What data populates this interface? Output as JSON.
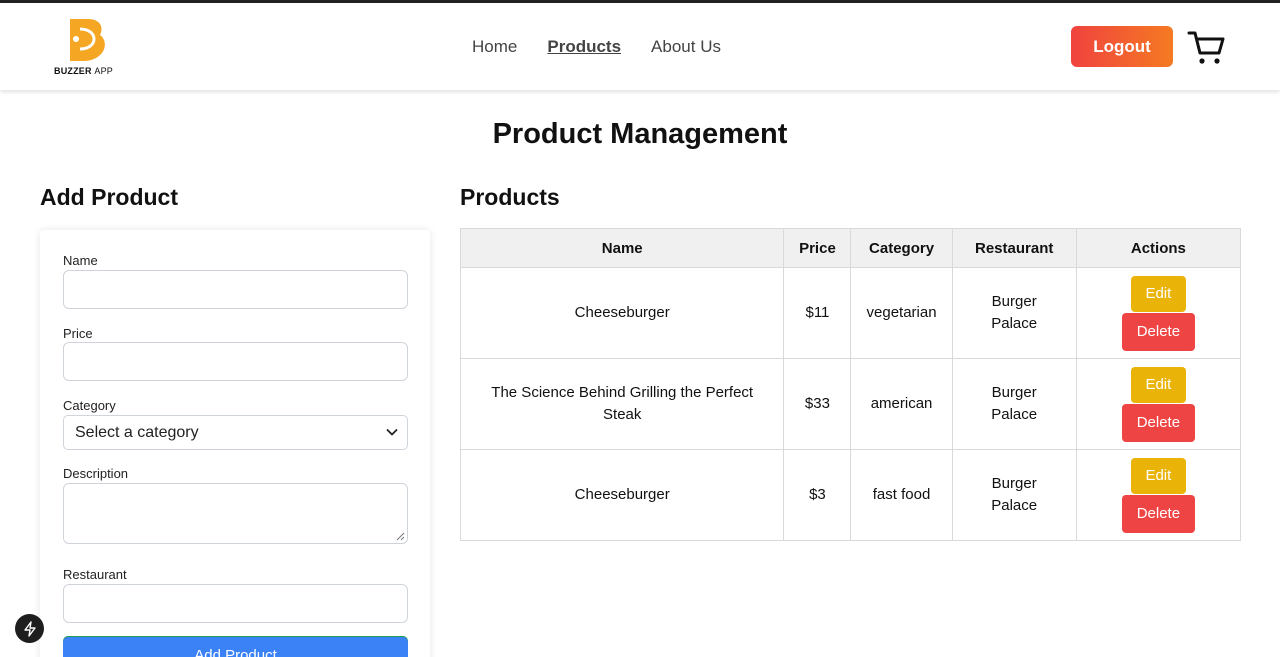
{
  "header": {
    "logo_brand": "BUZZER",
    "logo_suffix": "APP",
    "nav": [
      {
        "label": "Home",
        "active": false
      },
      {
        "label": "Products",
        "active": true
      },
      {
        "label": "About Us",
        "active": false
      }
    ],
    "logout_label": "Logout",
    "cart_icon": "shopping-cart-icon"
  },
  "page": {
    "title": "Product Management"
  },
  "form": {
    "title": "Add Product",
    "name_label": "Name",
    "name_value": "",
    "price_label": "Price",
    "price_value": "",
    "category_label": "Category",
    "category_selected": "Select a category",
    "description_label": "Description",
    "restaurant_label": "Restaurant",
    "restaurant_value": "",
    "submit_label": "Add Product"
  },
  "products": {
    "title": "Products",
    "columns": [
      "Name",
      "Price",
      "Category",
      "Restaurant",
      "Actions"
    ],
    "rows": [
      {
        "name": "Cheeseburger",
        "price": "$11",
        "category": "vegetarian",
        "restaurant": "Burger Palace",
        "edit": "Edit",
        "delete": "Delete"
      },
      {
        "name": "The Science Behind Grilling the Perfect Steak",
        "price": "$33",
        "category": "american",
        "restaurant": "Burger Palace",
        "edit": "Edit",
        "delete": "Delete"
      },
      {
        "name": "Cheeseburger",
        "price": "$3",
        "category": "fast food",
        "restaurant": "Burger Palace",
        "edit": "Edit",
        "delete": "Delete"
      }
    ]
  },
  "colors": {
    "logout_gradient_start": "#f0433f",
    "logout_gradient_end": "#f57a22",
    "edit_button": "#eab308",
    "delete_button": "#ef4444",
    "submit_button": "#3b82f6",
    "logo_orange": "#f5a623"
  }
}
